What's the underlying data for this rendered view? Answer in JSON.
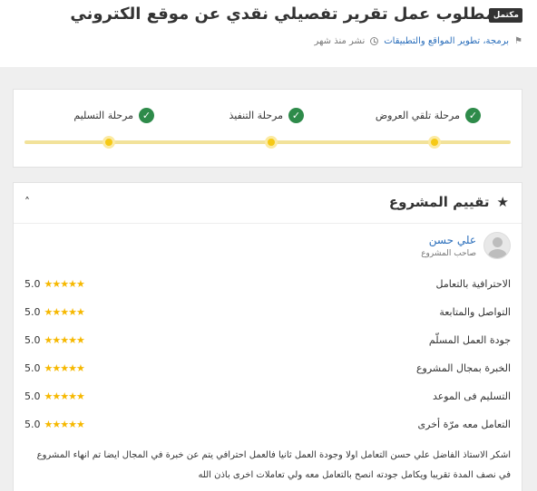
{
  "header": {
    "badge": "مكتمل",
    "title": "مطلوب عمل تقرير تفصيلي نقدي عن موقع الكتروني",
    "category": "برمجة، تطوير المواقع والتطبيقات",
    "published": "نشر منذ شهر"
  },
  "stages": [
    {
      "label": "مرحلة تلقي العروض"
    },
    {
      "label": "مرحلة التنفيذ"
    },
    {
      "label": "مرحلة التسليم"
    }
  ],
  "review": {
    "title": "تقييم المشروع",
    "reviewer_name": "علي حسن",
    "reviewer_role": "صاحب المشروع",
    "ratings": [
      {
        "label": "الاحترافية بالتعامل",
        "value": "5.0",
        "stars": 5
      },
      {
        "label": "التواصل والمتابعة",
        "value": "5.0",
        "stars": 5
      },
      {
        "label": "جودة العمل المسلّم",
        "value": "5.0",
        "stars": 5
      },
      {
        "label": "الخبرة بمجال المشروع",
        "value": "5.0",
        "stars": 5
      },
      {
        "label": "التسليم فى الموعد",
        "value": "5.0",
        "stars": 5
      },
      {
        "label": "التعامل معه مرّة أخرى",
        "value": "5.0",
        "stars": 5
      }
    ],
    "comment_line1": "اشكر الاستاذ الفاضل علي حسن التعامل اولا وجودة العمل ثانيا فالعمل احترافي يتم عن خبرة في المجال ايضا تم انهاء المشروع",
    "comment_line2": "في نصف المدة تقريبا ويكامل جودته انصح بالتعامل معه ولي تعاملات اخرى باذن الله"
  },
  "icons": {
    "tag": "tag-icon",
    "clock": "clock-icon",
    "check": "check-circle-icon",
    "star": "star-icon",
    "collapse": "chevron-up-icon"
  },
  "colors": {
    "check_green": "#2e8b4a",
    "progress_yellow": "#f6c915",
    "star_gold": "#f6b800",
    "link_blue": "#2a6ebb"
  }
}
